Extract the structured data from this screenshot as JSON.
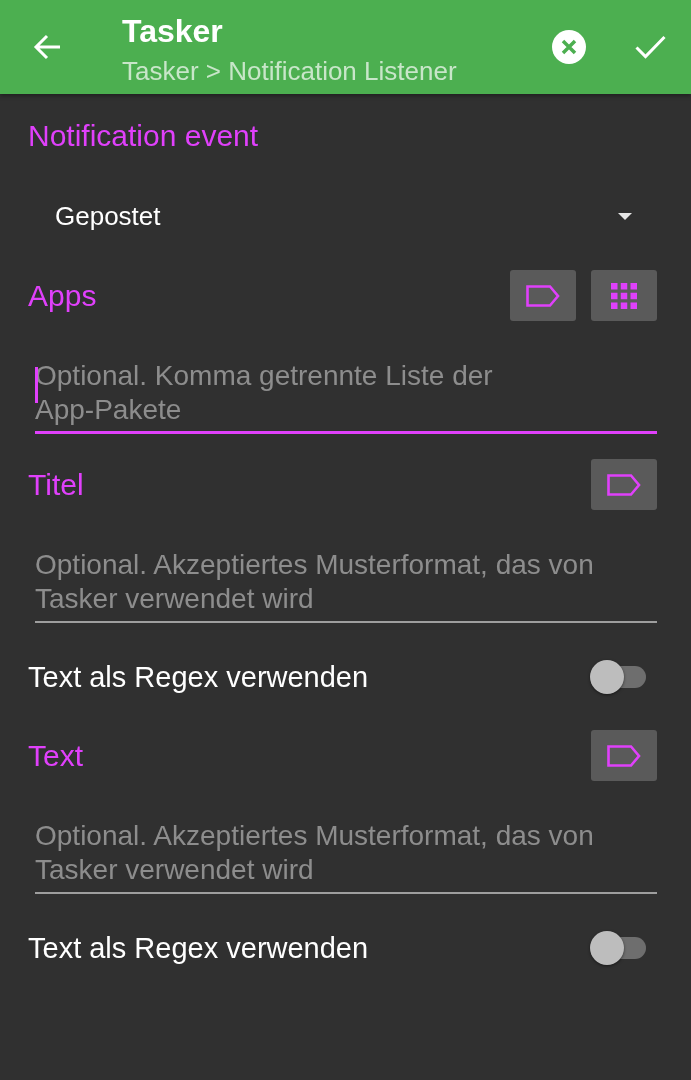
{
  "toolbar": {
    "title": "Tasker",
    "subtitle": "Tasker > Notification Listener"
  },
  "form": [
    {
      "kind": "select",
      "label": "Notification event",
      "value": "Gepostet"
    },
    {
      "kind": "text",
      "label": "Apps",
      "placeholder": "Optional. Komma getrennte Liste der App-Pakete",
      "focused": true,
      "actions": [
        {
          "kind": "variable"
        },
        {
          "kind": "picker"
        }
      ]
    },
    {
      "kind": "text",
      "label": "Titel",
      "placeholder": "Optional. Akzeptiertes Musterformat, das von Tasker verwendet wird",
      "focused": false,
      "actions": [
        {
          "kind": "variable"
        }
      ]
    },
    {
      "kind": "switch",
      "label": "Text als Regex verwenden",
      "on": false
    },
    {
      "kind": "text",
      "label": "Text",
      "placeholder": "Optional. Akzeptiertes Musterformat, das von Tasker verwendet wird",
      "focused": false,
      "actions": [
        {
          "kind": "variable"
        }
      ]
    },
    {
      "kind": "switch",
      "label": "Text als Regex verwenden",
      "on": false
    }
  ]
}
